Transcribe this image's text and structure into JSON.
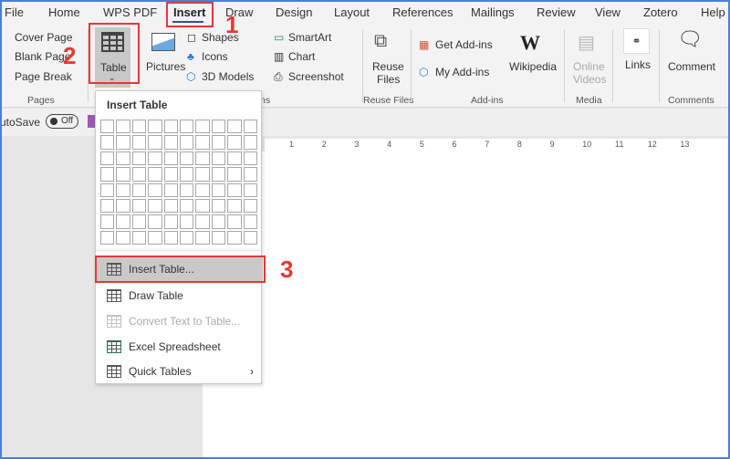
{
  "tabs": [
    "File",
    "Home",
    "WPS PDF",
    "Insert",
    "Draw",
    "Design",
    "Layout",
    "References",
    "Mailings",
    "Review",
    "View",
    "Zotero",
    "Help"
  ],
  "active_tab": "Insert",
  "ribbon": {
    "pages": {
      "cover": "Cover Page",
      "blank": "Blank Page",
      "break": "Page Break",
      "label": "Pages"
    },
    "table": "Table",
    "pictures": "Pictures",
    "illustrations": {
      "shapes": "Shapes",
      "icons": "Icons",
      "models": "3D Models",
      "smartart": "SmartArt",
      "chart": "Chart",
      "screenshot": "Screenshot",
      "label": "ns"
    },
    "reuse": {
      "l1": "Reuse",
      "l2": "Files",
      "label": "Reuse Files"
    },
    "addins": {
      "get": "Get Add-ins",
      "my": "My Add-ins",
      "wiki": "Wikipedia",
      "label": "Add-ins"
    },
    "media": {
      "l1": "Online",
      "l2": "Videos",
      "label": "Media"
    },
    "links": "Links",
    "comments": {
      "comment": "Comment",
      "label": "Comments"
    }
  },
  "qat": {
    "autosave": "utoSave",
    "toggle": "Off"
  },
  "ruler": [
    "1",
    "2",
    "3",
    "4",
    "5",
    "6",
    "7",
    "8",
    "9",
    "10",
    "11",
    "12",
    "13"
  ],
  "menu": {
    "title": "Insert Table",
    "grid_cols": 10,
    "grid_rows": 8,
    "items": [
      {
        "label": "Insert Table...",
        "disabled": false
      },
      {
        "label": "Draw Table",
        "disabled": false
      },
      {
        "label": "Convert Text to Table...",
        "disabled": true
      },
      {
        "label": "Excel Spreadsheet",
        "disabled": false
      },
      {
        "label": "Quick Tables",
        "disabled": false
      }
    ]
  },
  "annotations": [
    "1",
    "2",
    "3"
  ],
  "colors": {
    "accent": "#2b579a",
    "annotation": "#e53935"
  }
}
